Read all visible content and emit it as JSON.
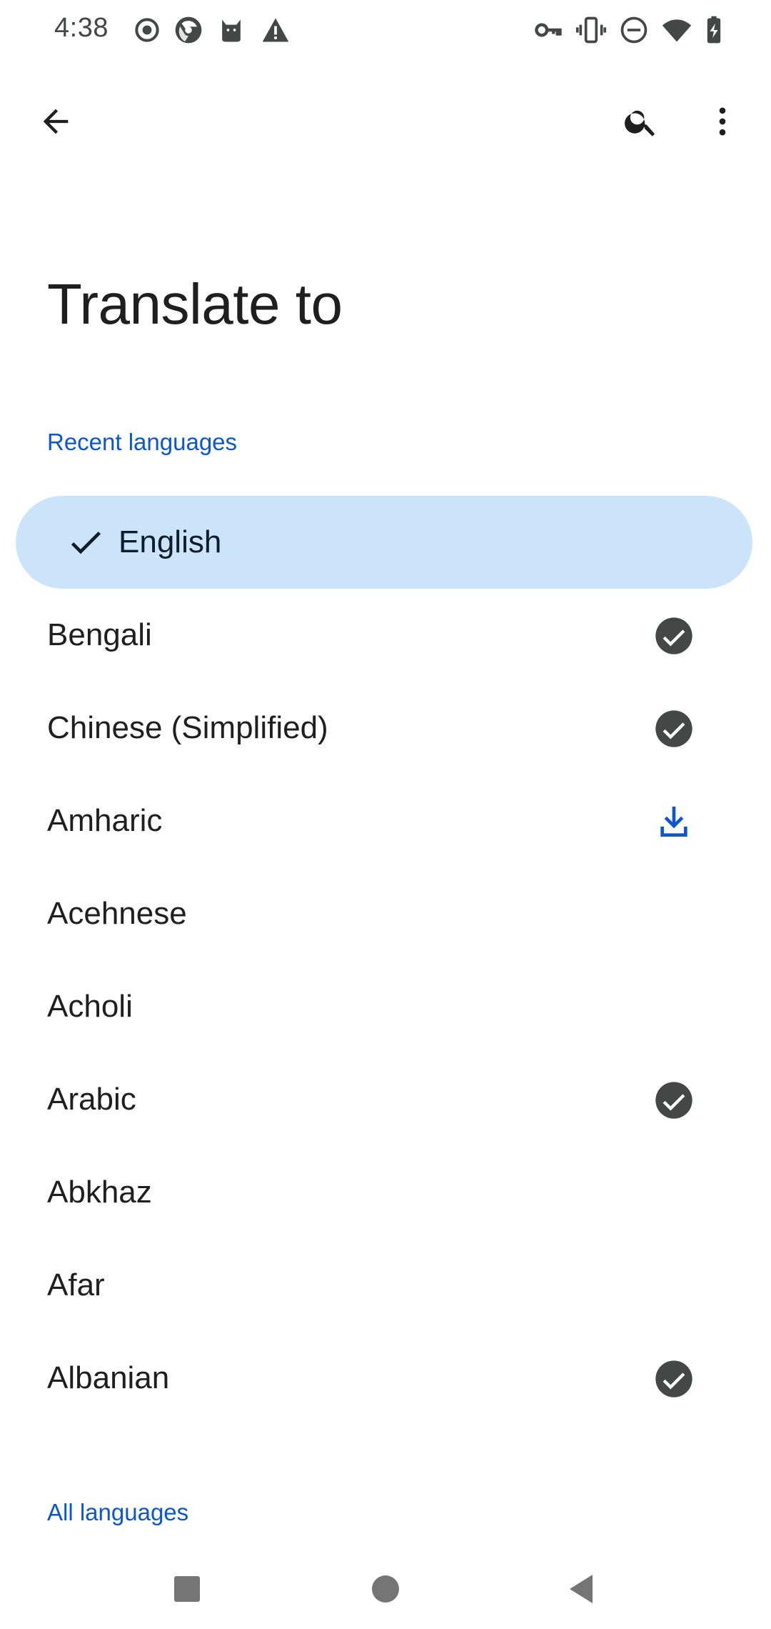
{
  "status_bar": {
    "time": "4:38",
    "left_icons": [
      "record-icon",
      "browser-icon",
      "cat-icon",
      "warning-icon"
    ],
    "right_icons": [
      "vpn-key-icon",
      "vibrate-icon",
      "do-not-disturb-icon",
      "wifi-icon",
      "battery-charging-icon"
    ]
  },
  "app_bar": {
    "back_icon": "arrow-back-icon",
    "search_icon": "search-icon",
    "more_icon": "more-vert-icon"
  },
  "page": {
    "title": "Translate to"
  },
  "recent": {
    "header": "Recent languages",
    "selected": {
      "label": "English",
      "icon": "check-icon"
    },
    "items": [
      {
        "label": "Bengali",
        "status": "downloaded"
      },
      {
        "label": "Chinese (Simplified)",
        "status": "downloaded"
      },
      {
        "label": "Amharic",
        "status": "download-available"
      },
      {
        "label": "Acehnese",
        "status": "none"
      },
      {
        "label": "Acholi",
        "status": "none"
      },
      {
        "label": "Arabic",
        "status": "downloaded"
      },
      {
        "label": "Abkhaz",
        "status": "none"
      },
      {
        "label": "Afar",
        "status": "none"
      },
      {
        "label": "Albanian",
        "status": "downloaded"
      }
    ]
  },
  "all": {
    "header": "All languages"
  },
  "colors": {
    "accent": "#0b57d0",
    "selected_bg": "#cce4fa",
    "downloaded_badge": "#444746",
    "text": "#1f1f1f"
  },
  "nav_bar": {
    "recents_icon": "square-icon",
    "home_icon": "circle-icon",
    "back_icon": "triangle-back-icon"
  }
}
